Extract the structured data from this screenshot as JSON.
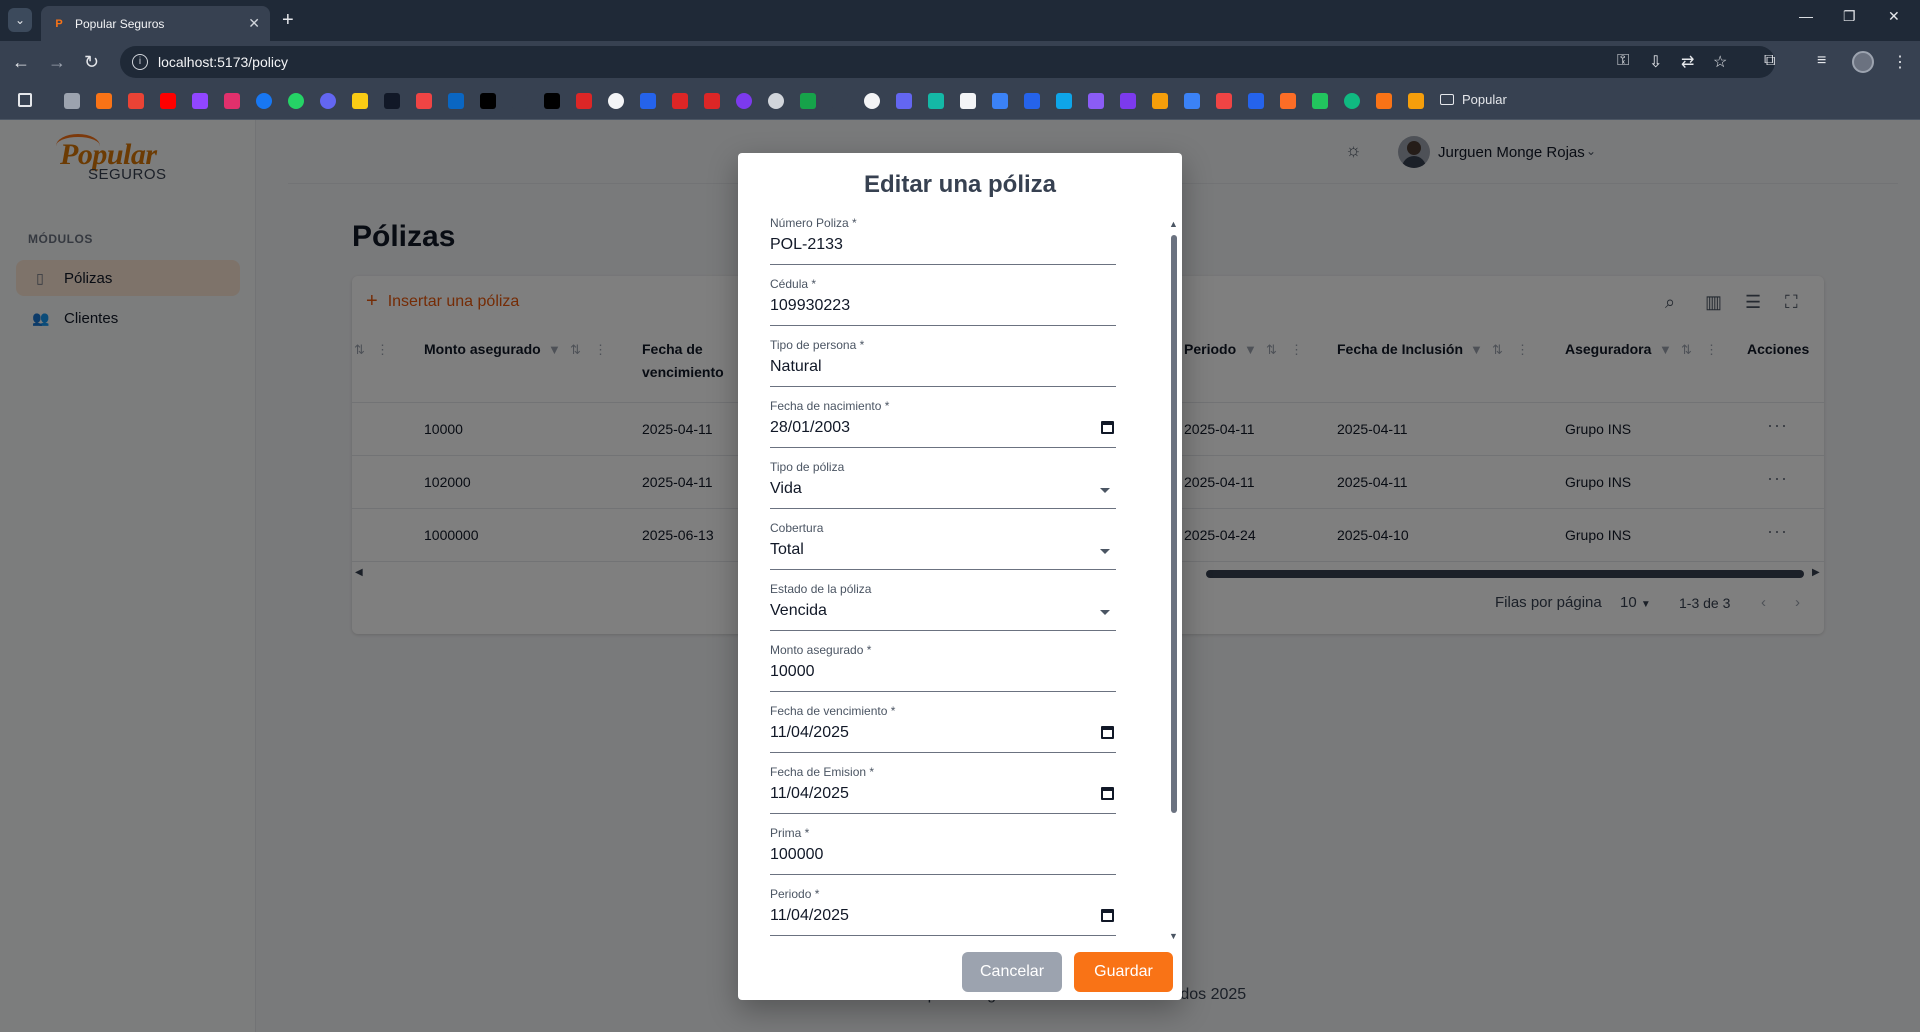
{
  "browser": {
    "tab_title": "Popular Seguros",
    "url": "localhost:5173/policy",
    "bookmark_folder": "Popular"
  },
  "app": {
    "logo_main": "Popular",
    "logo_sub": "SEGUROS",
    "sidebar": {
      "section_label": "MÓDULOS",
      "items": [
        {
          "label": "Pólizas",
          "active": true
        },
        {
          "label": "Clientes",
          "active": false
        }
      ]
    },
    "user_name": "Jurguen Monge Rojas",
    "page_title": "Pólizas",
    "footer": "Popular Seguros © Derechos Reservados 2025"
  },
  "table": {
    "insert_label": "Insertar una póliza",
    "columns": {
      "monto": "Monto asegurado",
      "fecha_venc_1": "Fecha de",
      "fecha_venc_2": "vencimiento",
      "periodo": "Periodo",
      "fecha_incl": "Fecha de Inclusión",
      "aseguradora": "Aseguradora",
      "acciones": "Acciones"
    },
    "rows": [
      {
        "monto": "10000",
        "vencimiento": "2025-04-11",
        "periodo": "2025-04-11",
        "inclusion": "2025-04-11",
        "aseguradora": "Grupo INS"
      },
      {
        "monto": "102000",
        "vencimiento": "2025-04-11",
        "periodo": "2025-04-11",
        "inclusion": "2025-04-11",
        "aseguradora": "Grupo INS"
      },
      {
        "monto": "1000000",
        "vencimiento": "2025-06-13",
        "periodo": "2025-04-24",
        "inclusion": "2025-04-10",
        "aseguradora": "Grupo INS"
      }
    ],
    "rows_per_page_label": "Filas por página",
    "rows_per_page": "10",
    "range": "1-3 de 3"
  },
  "modal": {
    "title": "Editar una póliza",
    "fields": [
      {
        "label": "Número Poliza *",
        "value": "POL-2133",
        "kind": "text"
      },
      {
        "label": "Cédula *",
        "value": "109930223",
        "kind": "text"
      },
      {
        "label": "Tipo de persona *",
        "value": "Natural",
        "kind": "text"
      },
      {
        "label": "Fecha de nacimiento *",
        "value": "28/01/2003",
        "kind": "date"
      },
      {
        "label": "Tipo de póliza",
        "value": "Vida",
        "kind": "select"
      },
      {
        "label": "Cobertura",
        "value": "Total",
        "kind": "select"
      },
      {
        "label": "Estado de la póliza",
        "value": "Vencida",
        "kind": "select"
      },
      {
        "label": "Monto asegurado *",
        "value": "10000",
        "kind": "text"
      },
      {
        "label": "Fecha de vencimiento *",
        "value": "11/04/2025",
        "kind": "date"
      },
      {
        "label": "Fecha de Emision *",
        "value": "11/04/2025",
        "kind": "date"
      },
      {
        "label": "Prima *",
        "value": "100000",
        "kind": "text"
      },
      {
        "label": "Periodo *",
        "value": "11/04/2025",
        "kind": "date"
      }
    ],
    "cancel_label": "Cancelar",
    "save_label": "Guardar"
  },
  "colors": {
    "accent": "#f97316",
    "active_nav_bg": "#fde7d4",
    "cancel_bg": "#9ca3af"
  }
}
